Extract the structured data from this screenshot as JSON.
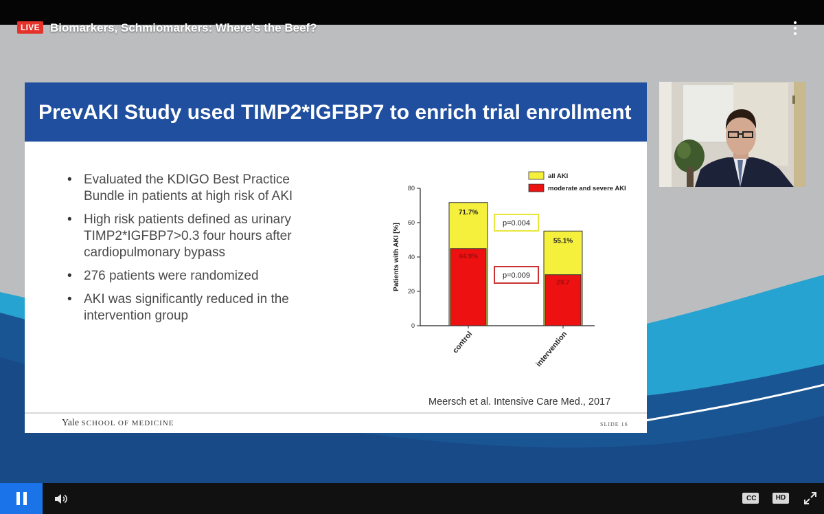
{
  "video": {
    "live_badge": "LIVE",
    "title": "Biomarkers, Schmiomarkers: Where's the Beef?"
  },
  "slide": {
    "title": "PrevAKI Study used TIMP2*IGFBP7 to enrich trial enrollment",
    "bullets": [
      "Evaluated the KDIGO Best Practice Bundle in patients at high risk of AKI",
      "High risk patients defined as urinary TIMP2*IGFBP7>0.3 four hours after cardiopulmonary bypass",
      "276 patients were randomized",
      "AKI was significantly reduced in the intervention group"
    ],
    "citation": "Meersch et al. Intensive Care Med., 2017",
    "footer_brand": "Yale",
    "footer_school": "SCHOOL OF MEDICINE",
    "slide_number": "SLIDE 16"
  },
  "chart_data": {
    "type": "bar",
    "categories": [
      "control",
      "intervention"
    ],
    "series": [
      {
        "name": "all AKI",
        "values": [
          71.7,
          55.1
        ],
        "color": "#f5f03c"
      },
      {
        "name": "moderate and severe AKI",
        "values": [
          44.9,
          29.7
        ],
        "color": "#ee1111"
      }
    ],
    "value_labels": {
      "all AKI": [
        "71.7%",
        "55.1%"
      ],
      "moderate and severe AKI": [
        "44.9%",
        "29.7"
      ]
    },
    "annotations": [
      {
        "text": "p=0.004",
        "color": "#e8e83a"
      },
      {
        "text": "p=0.009",
        "color": "#c83232"
      }
    ],
    "ylabel": "Patients with AKI [%]",
    "ylim": [
      0,
      80
    ],
    "yticks": [
      0,
      20,
      40,
      60,
      80
    ],
    "legend": "top-right",
    "grid": false
  },
  "controls": {
    "cc_label": "CC",
    "hd_label": "HD"
  },
  "colors": {
    "live_red": "#e5322b",
    "play_blue": "#1a73e8",
    "slide_header_blue": "#1f4f9e"
  },
  "icons": {
    "menu": "kebab-menu-icon",
    "pause": "pause-icon",
    "volume": "volume-icon",
    "fullscreen": "fullscreen-icon"
  }
}
